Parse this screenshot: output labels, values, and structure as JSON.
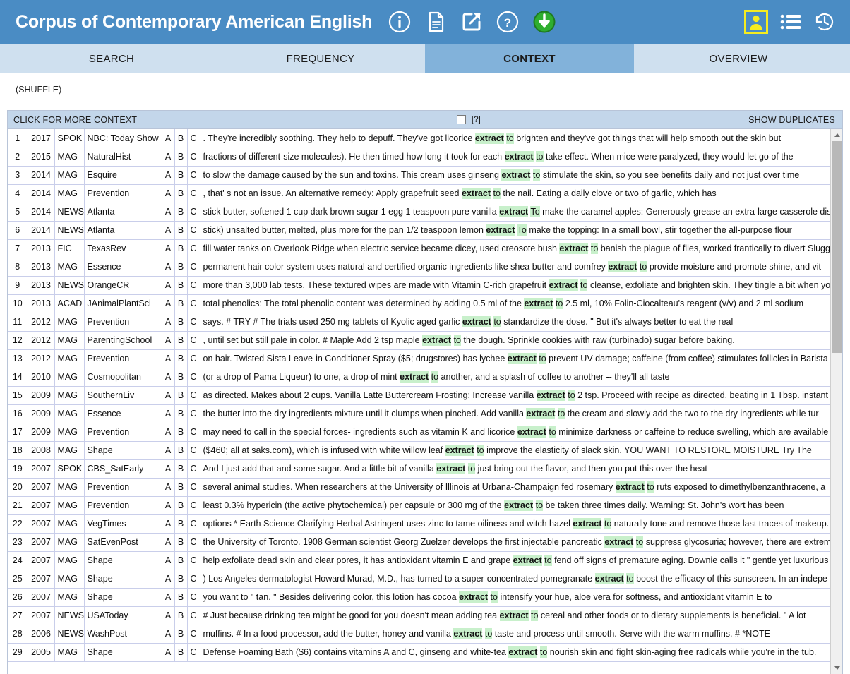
{
  "header": {
    "title": "Corpus of Contemporary American English",
    "icons": [
      {
        "name": "info-icon",
        "label": "info"
      },
      {
        "name": "document-icon",
        "label": "document"
      },
      {
        "name": "external-link-icon",
        "label": "share"
      },
      {
        "name": "help-icon",
        "label": "help"
      },
      {
        "name": "download-icon",
        "label": "download"
      }
    ],
    "right_icons": [
      {
        "name": "user-account-icon",
        "label": "account"
      },
      {
        "name": "list-icon",
        "label": "list"
      },
      {
        "name": "history-icon",
        "label": "history"
      }
    ],
    "colors": {
      "header_bg": "#4a8cc4",
      "tabbar_bg": "#cfe0ef",
      "tab_active_bg": "#82b2da",
      "toolbar_bg": "#c3d6ea",
      "highlight": "#c8f0cb",
      "user_icon_accent": "#f5ec1f",
      "download_icon_accent": "#29a329"
    }
  },
  "tabs": [
    {
      "label": "SEARCH",
      "active": false
    },
    {
      "label": "FREQUENCY",
      "active": false
    },
    {
      "label": "CONTEXT",
      "active": true
    },
    {
      "label": "OVERVIEW",
      "active": false
    }
  ],
  "shuffle": {
    "label": "(SHUFFLE)"
  },
  "toolbar": {
    "more_context": "CLICK FOR MORE CONTEXT",
    "help_marker": "[?]",
    "show_duplicates": "SHOW DUPLICATES",
    "checkbox_checked": false
  },
  "columns": {
    "a": "A",
    "b": "B",
    "c": "C"
  },
  "rows": [
    {
      "n": "1",
      "year": "2017",
      "genre": "SPOK",
      "source": "NBC: Today Show",
      "pre": ". They're incredibly soothing. They help to depuff. They've got licorice ",
      "kw": "extract to",
      "post": " brighten and they've got things that will help smooth out the skin but"
    },
    {
      "n": "2",
      "year": "2015",
      "genre": "MAG",
      "source": "NaturalHist",
      "pre": "fractions of different-size molecules). He then timed how long it took for each ",
      "kw": "extract to",
      "post": " take effect. When mice were paralyzed, they would let go of the"
    },
    {
      "n": "3",
      "year": "2014",
      "genre": "MAG",
      "source": "Esquire",
      "pre": "to slow the damage caused by the sun and toxins. This cream uses ginseng ",
      "kw": "extract to",
      "post": " stimulate the skin, so you see benefits daily and not just over time"
    },
    {
      "n": "4",
      "year": "2014",
      "genre": "MAG",
      "source": "Prevention",
      "pre": ", that' s not an issue. An alternative remedy: Apply grapefruit seed ",
      "kw": "extract to",
      "post": " the nail. Eating a daily clove or two of garlic, which has"
    },
    {
      "n": "5",
      "year": "2014",
      "genre": "NEWS",
      "source": "Atlanta",
      "pre": "stick butter, softened 1 cup dark brown sugar 1 egg 1 teaspoon pure vanilla ",
      "kw": "extract To",
      "post": " make the caramel apples: Generously grease an extra-large casserole dish"
    },
    {
      "n": "6",
      "year": "2014",
      "genre": "NEWS",
      "source": "Atlanta",
      "pre": "stick) unsalted butter, melted, plus more for the pan 1/2 teaspoon lemon ",
      "kw": "extract To",
      "post": " make the topping: In a small bowl, stir together the all-purpose flour"
    },
    {
      "n": "7",
      "year": "2013",
      "genre": "FIC",
      "source": "TexasRev",
      "pre": "fill water tanks on Overlook Ridge when electric service became dicey, used creosote bush ",
      "kw": "extract to",
      "post": " banish the plague of flies, worked frantically to divert Slugg"
    },
    {
      "n": "8",
      "year": "2013",
      "genre": "MAG",
      "source": "Essence",
      "pre": "permanent hair color system uses natural and certified organic ingredients like shea butter and comfrey ",
      "kw": "extract to",
      "post": " provide moisture and promote shine, and vit"
    },
    {
      "n": "9",
      "year": "2013",
      "genre": "NEWS",
      "source": "OrangeCR",
      "pre": "more than 3,000 lab tests. These textured wipes are made with Vitamin C-rich grapefruit ",
      "kw": "extract to",
      "post": " cleanse, exfoliate and brighten skin. They tingle a bit when yo"
    },
    {
      "n": "10",
      "year": "2013",
      "genre": "ACAD",
      "source": "JAnimalPlantSci",
      "pre": "total phenolics: The total phenolic content was determined by adding 0.5 ml of the ",
      "kw": "extract to",
      "post": " 2.5 ml, 10% Folin-Ciocalteau's reagent (v/v) and 2 ml sodium"
    },
    {
      "n": "11",
      "year": "2012",
      "genre": "MAG",
      "source": "Prevention",
      "pre": "says. # TRY # The trials used 250 mg tablets of Kyolic aged garlic ",
      "kw": "extract to",
      "post": " standardize the dose. \" But it's always better to eat the real"
    },
    {
      "n": "12",
      "year": "2012",
      "genre": "MAG",
      "source": "ParentingSchool",
      "pre": ", until set but still pale in color. # Maple Add 2 tsp maple ",
      "kw": "extract to",
      "post": " the dough. Sprinkle cookies with raw (turbinado) sugar before baking."
    },
    {
      "n": "13",
      "year": "2012",
      "genre": "MAG",
      "source": "Prevention",
      "pre": "on hair. Twisted Sista Leave-in Conditioner Spray ($5; drugstores) has lychee ",
      "kw": "extract to",
      "post": " prevent UV damage; caffeine (from coffee) stimulates follicles in Barista B"
    },
    {
      "n": "14",
      "year": "2010",
      "genre": "MAG",
      "source": "Cosmopolitan",
      "pre": "(or a drop of Pama Liqueur) to one, a drop of mint ",
      "kw": "extract to",
      "post": " another, and a splash of coffee to another -- they'll all taste"
    },
    {
      "n": "15",
      "year": "2009",
      "genre": "MAG",
      "source": "SouthernLiv",
      "pre": "as directed. Makes about 2 cups. Vanilla Latte Buttercream Frosting: Increase vanilla ",
      "kw": "extract to",
      "post": " 2 tsp. Proceed with recipe as directed, beating in 1 Tbsp. instant"
    },
    {
      "n": "16",
      "year": "2009",
      "genre": "MAG",
      "source": "Essence",
      "pre": "the butter into the dry ingredients mixture until it clumps when pinched. Add vanilla ",
      "kw": "extract to",
      "post": " the cream and slowly add the two to the dry ingredients while tur"
    },
    {
      "n": "17",
      "year": "2009",
      "genre": "MAG",
      "source": "Prevention",
      "pre": "may need to call in the special forces- ingredients such as vitamin K and licorice ",
      "kw": "extract to",
      "post": " minimize darkness or caffeine to reduce swelling, which are available"
    },
    {
      "n": "18",
      "year": "2008",
      "genre": "MAG",
      "source": "Shape",
      "pre": "($460; all at saks.com), which is infused with white willow leaf ",
      "kw": "extract to",
      "post": " improve the elasticity of slack skin. YOU WANT TO RESTORE MOISTURE Try The"
    },
    {
      "n": "19",
      "year": "2007",
      "genre": "SPOK",
      "source": "CBS_SatEarly",
      "pre": "And I just add that and some sugar. And a little bit of vanilla ",
      "kw": "extract to",
      "post": " just bring out the flavor, and then you put this over the heat"
    },
    {
      "n": "20",
      "year": "2007",
      "genre": "MAG",
      "source": "Prevention",
      "pre": "several animal studies. When researchers at the University of Illinois at Urbana-Champaign fed rosemary ",
      "kw": "extract to",
      "post": " ruts exposed to dimethylbenzanthracene, a"
    },
    {
      "n": "21",
      "year": "2007",
      "genre": "MAG",
      "source": "Prevention",
      "pre": "least 0.3% hypericin (the active phytochemical) per capsule or 300 mg of the ",
      "kw": "extract to",
      "post": " be taken three times daily. Warning: St. John's wort has been"
    },
    {
      "n": "22",
      "year": "2007",
      "genre": "MAG",
      "source": "VegTimes",
      "pre": "options * Earth Science Clarifying Herbal Astringent uses zinc to tame oiliness and witch hazel ",
      "kw": "extract to",
      "post": " naturally tone and remove those last traces of makeup."
    },
    {
      "n": "23",
      "year": "2007",
      "genre": "MAG",
      "source": "SatEvenPost",
      "pre": "the University of Toronto. 1908 German scientist Georg Zuelzer develops the first injectable pancreatic ",
      "kw": "extract to",
      "post": " suppress glycosuria; however, there are extrem"
    },
    {
      "n": "24",
      "year": "2007",
      "genre": "MAG",
      "source": "Shape",
      "pre": "help exfoliate dead skin and clear pores, it has antioxidant vitamin E and grape ",
      "kw": "extract to",
      "post": " fend off signs of premature aging. Downie calls it \" gentle yet luxurious"
    },
    {
      "n": "25",
      "year": "2007",
      "genre": "MAG",
      "source": "Shape",
      "pre": ") Los Angeles dermatologist Howard Murad, M.D., has turned to a super-concentrated pomegranate ",
      "kw": "extract to",
      "post": " boost the efficacy of this sunscreen. In an indepe"
    },
    {
      "n": "26",
      "year": "2007",
      "genre": "MAG",
      "source": "Shape",
      "pre": "you want to \" tan. \" Besides delivering color, this lotion has cocoa ",
      "kw": "extract to",
      "post": " intensify your hue, aloe vera for softness, and antioxidant vitamin E to"
    },
    {
      "n": "27",
      "year": "2007",
      "genre": "NEWS",
      "source": "USAToday",
      "pre": "# Just because drinking tea might be good for you doesn't mean adding tea ",
      "kw": "extract to",
      "post": " cereal and other foods or to dietary supplements is beneficial. \" A lot"
    },
    {
      "n": "28",
      "year": "2006",
      "genre": "NEWS",
      "source": "WashPost",
      "pre": "muffins. # In a food processor, add the butter, honey and vanilla ",
      "kw": "extract to",
      "post": " taste and process until smooth. Serve with the warm muffins. # *NOTE"
    },
    {
      "n": "29",
      "year": "2005",
      "genre": "MAG",
      "source": "Shape",
      "pre": "Defense Foaming Bath ($6) contains vitamins A and C, ginseng and white-tea ",
      "kw": "extract to",
      "post": " nourish skin and fight skin-aging free radicals while you're in the tub."
    }
  ]
}
